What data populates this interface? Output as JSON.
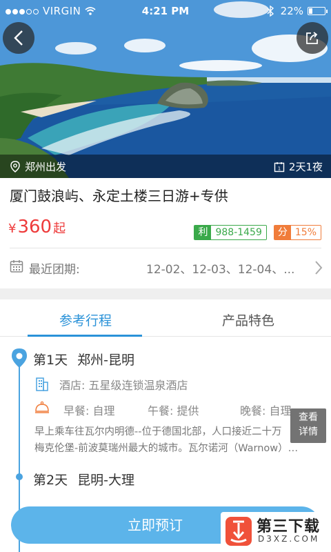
{
  "status_bar": {
    "carrier": "VIRGIN",
    "time": "4:21 PM",
    "battery": "22%",
    "battery_level": 0.22
  },
  "hero": {
    "departure": "郑州出发",
    "duration": "2天1夜"
  },
  "product": {
    "title": "厦门鼓浪屿、永定土楼三日游+专供",
    "price_currency": "¥",
    "price_value": "360",
    "price_suffix": "起",
    "tag_profit_key": "利",
    "tag_profit_value": "988-1459",
    "tag_share_key": "分",
    "tag_share_value": "15%"
  },
  "departure_dates": {
    "label": "最近团期:",
    "values": "12-02、12-03、12-04、..."
  },
  "tabs": [
    {
      "label": "参考行程",
      "active": true
    },
    {
      "label": "产品特色",
      "active": false
    }
  ],
  "itinerary": {
    "day1": {
      "day": "第1天",
      "route": "郑州-昆明",
      "hotel": "酒店:  五星级连锁温泉酒店",
      "breakfast": "早餐:  自理",
      "lunch": "午餐:  提供",
      "dinner": "晚餐:  自理",
      "desc_line1": "早上乘车往瓦尔内明德--位于德国北部，人口接近二十万",
      "desc_line2": "梅克伦堡-前波莫瑞州最大的城市。瓦尔诺河（Warnow）…"
    },
    "day2": {
      "day": "第2天",
      "route": "昆明-大理"
    },
    "detail_button": [
      "查看",
      "详情"
    ]
  },
  "bottom": {
    "book_label": "立即预订"
  },
  "watermark": {
    "name": "第三下载",
    "domain": "D3XZ.COM"
  },
  "colors": {
    "accent": "#2a92d8",
    "price": "#ee3b3b",
    "tag_green": "#3aa94a",
    "tag_orange": "#f07c3a",
    "book_button": "#5cb4ea"
  }
}
